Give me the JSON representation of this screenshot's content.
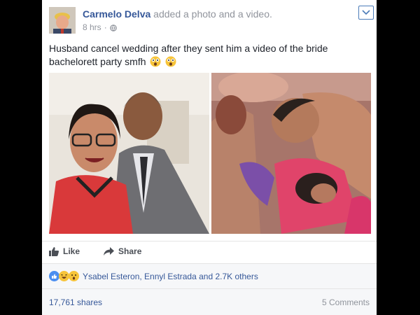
{
  "post": {
    "author": "Carmelo Delva",
    "action": "added a photo and a video.",
    "time": "8 hrs",
    "separator": "·",
    "text": "Husband cancel wedding after they sent him a video of the bride bachelorett party smfh",
    "text_emojis": [
      "astonished-face",
      "astonished-face"
    ]
  },
  "icons": {
    "globe": "globe-icon",
    "menu": "chevron-down-icon",
    "like": "thumbs-up-icon",
    "share": "share-arrow-icon",
    "reactions": [
      "like-reaction-icon",
      "haha-reaction-icon",
      "wow-reaction-icon"
    ]
  },
  "actions": {
    "like_label": "Like",
    "share_label": "Share"
  },
  "reactions": {
    "summary": "Ysabel Esteron, Ennyl Estrada and 2.7K others"
  },
  "stats": {
    "shares": "17,761 shares",
    "comments": "5 Comments"
  },
  "colors": {
    "link_blue": "#365899",
    "muted_gray": "#90949c",
    "like_blue": "#4b7bb8",
    "bar_bg": "#f6f7f9",
    "page_bg": "#000000"
  }
}
